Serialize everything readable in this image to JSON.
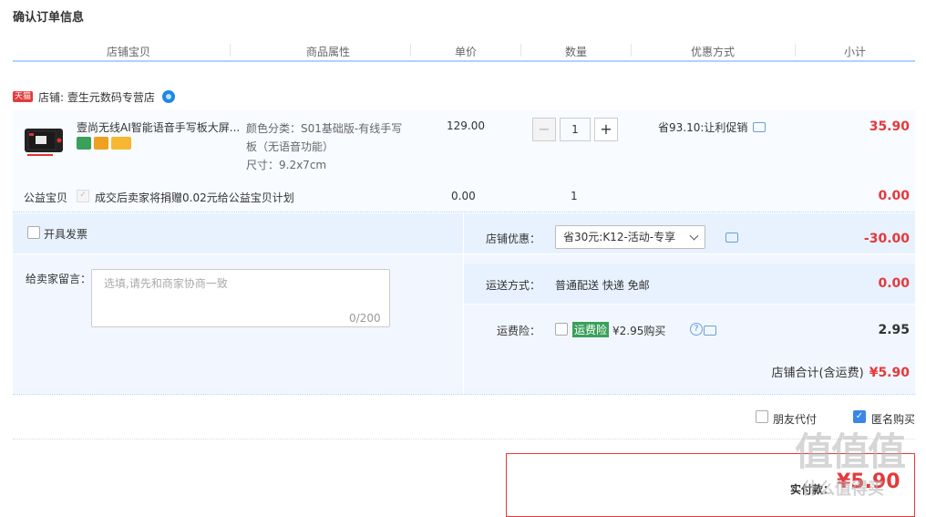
{
  "page": {
    "title": "确认订单信息"
  },
  "table_headers": [
    "店铺宝贝",
    "商品属性",
    "单价",
    "数量",
    "优惠方式",
    "小计"
  ],
  "shop": {
    "badge": "天猫",
    "label": "店铺: 壹生元数码专营店"
  },
  "item": {
    "name": "壹尚无线AI智能语音手写板大屏...",
    "attr_lines": [
      "颜色分类：S01基础版-有线手写",
      "板（无语音功能）",
      "尺寸：9.2x7cm"
    ],
    "price": "129.00",
    "quantity": "1",
    "minus": "−",
    "plus": "+",
    "promo": "省93.10:让利促销",
    "subtotal": "35.90"
  },
  "charity": {
    "label": "公益宝贝",
    "check": "✓",
    "text": "成交后卖家将捐赠0.02元给公益宝贝计划",
    "price": "0.00",
    "quantity": "1",
    "subtotal": "0.00"
  },
  "invoice": {
    "label": "开具发票"
  },
  "message": {
    "label": "给卖家留言：",
    "placeholder": "选填,请先和商家协商一致",
    "count": "0/200"
  },
  "shop_discount": {
    "label": "店铺优惠：",
    "selected": "省30元:K12-活动-专享",
    "value": "-30.00"
  },
  "shipping": {
    "label": "运送方式：",
    "method": "普通配送 快递 免邮",
    "value": "0.00"
  },
  "insurance": {
    "label": "运费险：",
    "tag": "运费险",
    "text": "¥2.95购买",
    "help": "?",
    "value": "2.95"
  },
  "shop_total": {
    "label": "店铺合计(含运费)",
    "value": "¥5.90"
  },
  "options": {
    "friend_pay": "朋友代付",
    "anonymous": "匿名购买",
    "anon_check": "✓"
  },
  "payment": {
    "label": "实付款：",
    "amount": "¥5.90"
  },
  "watermark": {
    "big": "值值值",
    "small": "什么值得买"
  },
  "colors": {
    "accent_red": "#e4393c",
    "blue_border": "#b2d1ff",
    "panel_bg": "#f2f7ff",
    "insurance_green": "#3aa05a"
  }
}
